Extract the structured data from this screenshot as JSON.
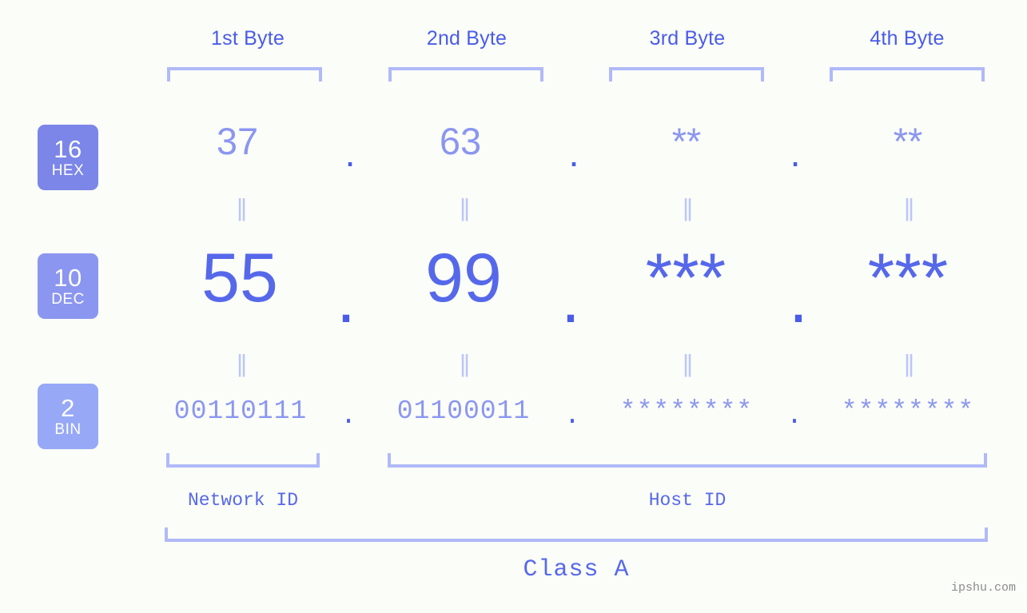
{
  "header": {
    "byte_labels": [
      "1st Byte",
      "2nd Byte",
      "3rd Byte",
      "4th Byte"
    ]
  },
  "rows": [
    {
      "badge_number": "16",
      "badge_name": "HEX",
      "values": [
        "37",
        "63",
        "**",
        "**"
      ],
      "separators": [
        ".",
        ".",
        "."
      ]
    },
    {
      "badge_number": "10",
      "badge_name": "DEC",
      "values": [
        "55",
        "99",
        "***",
        "***"
      ],
      "separators": [
        ".",
        ".",
        "."
      ]
    },
    {
      "badge_number": "2",
      "badge_name": "BIN",
      "values": [
        "00110111",
        "01100011",
        "********",
        "********"
      ],
      "separators": [
        ".",
        ".",
        "."
      ]
    }
  ],
  "equality_marks": {
    "hex_to_dec": [
      "||",
      "||",
      "||",
      "||"
    ],
    "dec_to_bin": [
      "||",
      "||",
      "||",
      "||"
    ]
  },
  "footer": {
    "network_id_label": "Network ID",
    "host_id_label": "Host ID",
    "class_label": "Class A"
  },
  "watermark": "ipshu.com",
  "colors": {
    "background": "#fbfdf8",
    "accent_dark": "#4a5ce8",
    "accent_mid": "#5668ea",
    "accent_light": "#8b96f0",
    "bracket": "#b0baf8",
    "tick": "#bcc6fb",
    "badge_hex": "#7b86e8",
    "badge_dec": "#8b96f0",
    "badge_bin": "#96a8f6",
    "watermark": "#8c8c8c"
  }
}
